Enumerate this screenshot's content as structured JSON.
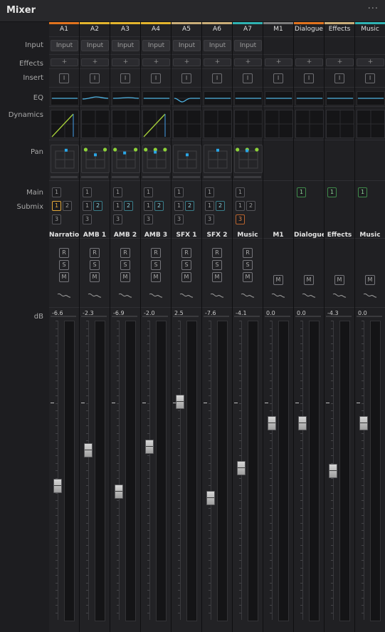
{
  "window": {
    "title": "Mixer",
    "menu_glyph": "···"
  },
  "row_labels": {
    "input": "Input",
    "effects": "Effects",
    "insert": "Insert",
    "eq": "EQ",
    "dynamics": "Dynamics",
    "pan": "Pan",
    "main": "Main",
    "submix": "Submix",
    "db": "dB"
  },
  "button_labels": {
    "input": "Input",
    "effects": "+",
    "insert": "I",
    "record": "R",
    "solo": "S",
    "mute": "M"
  },
  "colors": {
    "bar_orange": "#e1731e",
    "bar_yellow": "#e3b42d",
    "bar_tan": "#c9ad78",
    "bar_teal": "#2fb2b2",
    "bar_gray": "#7c7c7c",
    "pan_blue": "#2aa6e6",
    "pan_green": "#8dd23a",
    "eq_blue": "#4fb3e3"
  },
  "strips": [
    {
      "id": "A1",
      "bar": "#e1731e",
      "track": "Narration",
      "db": "-6.6",
      "level": 0.45,
      "type": "track",
      "main": [
        "1"
      ],
      "submix": [
        {
          "n": "1",
          "c": "on"
        },
        {
          "n": "2",
          "c": ""
        },
        {
          "n": "3",
          "c": ""
        }
      ],
      "eq": "flat",
      "dyn": "slope",
      "pan": {
        "dots": [],
        "sq": [
          0.55,
          0.18
        ]
      }
    },
    {
      "id": "A2",
      "bar": "#e3b42d",
      "track": "AMB 1",
      "db": "-2.3",
      "level": 0.57,
      "type": "track",
      "main": [
        "1"
      ],
      "submix": [
        {
          "n": "1",
          "c": ""
        },
        {
          "n": "2",
          "c": "tl"
        },
        {
          "n": "3",
          "c": ""
        }
      ],
      "eq": "curve",
      "dyn": "none",
      "pan": {
        "dots": [
          0.1,
          0.9
        ],
        "sq": [
          0.5,
          0.35
        ]
      }
    },
    {
      "id": "A3",
      "bar": "#e3b42d",
      "track": "AMB 2",
      "db": "-6.9",
      "level": 0.43,
      "type": "track",
      "main": [
        "1"
      ],
      "submix": [
        {
          "n": "1",
          "c": ""
        },
        {
          "n": "2",
          "c": "tl"
        },
        {
          "n": "3",
          "c": ""
        }
      ],
      "eq": "slightcurve",
      "dyn": "none",
      "pan": {
        "dots": [
          0.05,
          0.9
        ],
        "sq": [
          0.45,
          0.28
        ]
      }
    },
    {
      "id": "A4",
      "bar": "#e3b42d",
      "track": "AMB 3",
      "db": "-2.0",
      "level": 0.58,
      "type": "track",
      "main": [
        "1"
      ],
      "submix": [
        {
          "n": "1",
          "c": ""
        },
        {
          "n": "2",
          "c": "tl"
        },
        {
          "n": "3",
          "c": ""
        }
      ],
      "eq": "flat",
      "dyn": "slope",
      "pan": {
        "dots": [
          0.05,
          0.45,
          0.85
        ],
        "sq": [
          0.45,
          0.25
        ]
      }
    },
    {
      "id": "A5",
      "bar": "#c9ad78",
      "track": "SFX 1",
      "db": "2.5",
      "level": 0.73,
      "type": "track",
      "main": [
        "1"
      ],
      "submix": [
        {
          "n": "1",
          "c": ""
        },
        {
          "n": "2",
          "c": "tl"
        },
        {
          "n": "3",
          "c": ""
        }
      ],
      "eq": "dip",
      "dyn": "none",
      "pan": {
        "dots": [],
        "sq": [
          0.5,
          0.35
        ]
      }
    },
    {
      "id": "A6",
      "bar": "#c9ad78",
      "track": "SFX 2",
      "db": "-7.6",
      "level": 0.41,
      "type": "track",
      "main": [
        "1"
      ],
      "submix": [
        {
          "n": "1",
          "c": ""
        },
        {
          "n": "2",
          "c": "tl"
        },
        {
          "n": "3",
          "c": ""
        }
      ],
      "eq": "flat",
      "dyn": "none",
      "pan": {
        "dots": [],
        "sq": [
          0.5,
          0.18
        ]
      }
    },
    {
      "id": "A7",
      "bar": "#2fb2b2",
      "track": "Music",
      "db": "-4.1",
      "level": 0.51,
      "type": "track",
      "main": [
        "1"
      ],
      "submix": [
        {
          "n": "1",
          "c": ""
        },
        {
          "n": "2",
          "c": ""
        },
        {
          "n": "3",
          "c": "or"
        }
      ],
      "eq": "flat",
      "dyn": "none",
      "pan": {
        "dots": [
          0.05,
          0.45,
          0.85
        ],
        "sq": [
          0.45,
          0.2
        ]
      }
    },
    {
      "id": "M1",
      "bar": "#7c7c7c",
      "track": "M1",
      "db": "0.0",
      "level": 0.66,
      "type": "bus",
      "main": [],
      "submix": []
    },
    {
      "id": "Dialogue",
      "bar": "#e1731e",
      "track": "Dialogue",
      "db": "0.0",
      "level": 0.66,
      "type": "bus",
      "main": [
        "1"
      ],
      "submix": []
    },
    {
      "id": "Effects",
      "bar": "#c9ad78",
      "track": "Effects",
      "db": "-4.3",
      "level": 0.5,
      "type": "bus",
      "main": [
        "1"
      ],
      "submix": []
    },
    {
      "id": "Music",
      "bar": "#2fb2b2",
      "track": "Music",
      "db": "0.0",
      "level": 0.66,
      "type": "bus",
      "main": [
        "1"
      ],
      "submix": []
    }
  ]
}
